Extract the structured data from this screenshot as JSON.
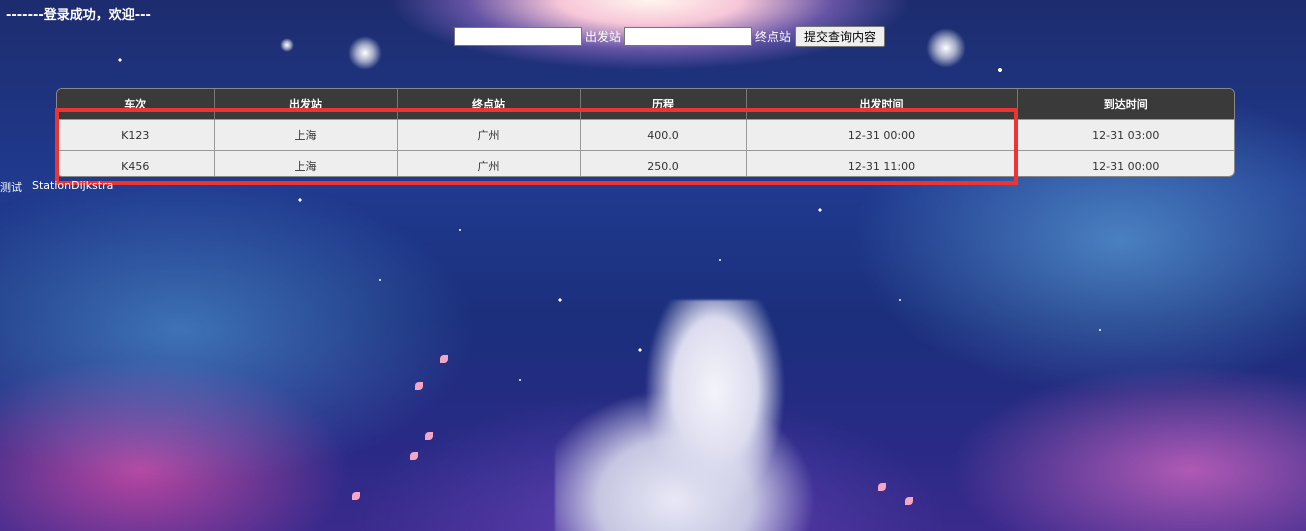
{
  "welcome_text": "-------登录成功，欢迎---",
  "search": {
    "from_value": "",
    "from_label": "出发站",
    "to_value": "",
    "to_label": "终点站",
    "submit_label": "提交查询内容"
  },
  "table": {
    "headers": [
      "车次",
      "出发站",
      "终点站",
      "历程",
      "出发时间",
      "到达时间"
    ],
    "rows": [
      [
        "K123",
        "上海",
        "广州",
        "400.0",
        "12-31 00:00",
        "12-31 03:00"
      ],
      [
        "K456",
        "上海",
        "广州",
        "250.0",
        "12-31 11:00",
        "12-31 00:00"
      ]
    ]
  },
  "footer": {
    "link_1": "测试",
    "link_2": "StationDijkstra"
  },
  "colors": {
    "highlight_border": "#ee3333",
    "header_bg": "#3a3a3a",
    "row_bg": "#eeeeee"
  }
}
